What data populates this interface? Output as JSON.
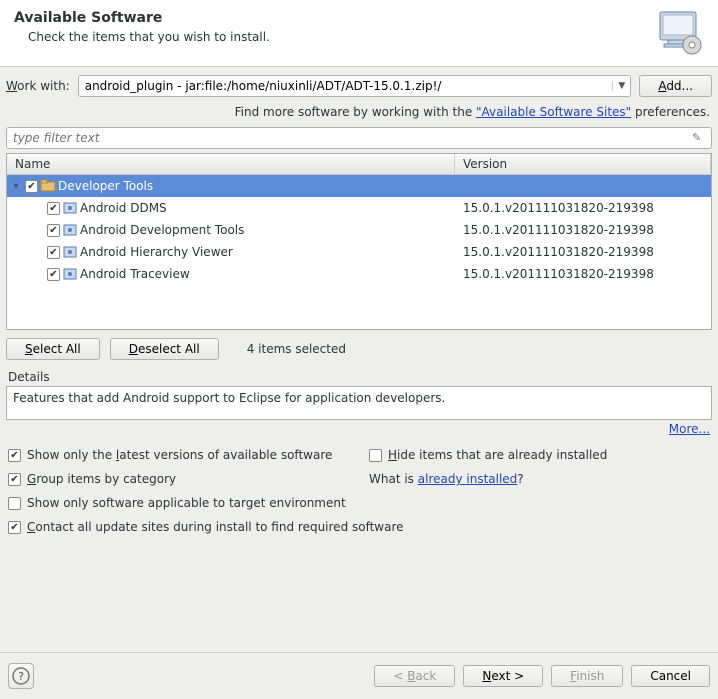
{
  "header": {
    "title": "Available Software",
    "subtitle": "Check the items that you wish to install."
  },
  "workwith": {
    "label_pre": "W",
    "label_post": "ork with:",
    "value": "android_plugin - jar:file:/home/niuxinli/ADT/ADT-15.0.1.zip!/",
    "add_btn_pre": "A",
    "add_btn_post": "dd..."
  },
  "hint": {
    "pre": "Find more software by working with the ",
    "link": "\"Available Software Sites\"",
    "post": " preferences."
  },
  "filter": {
    "placeholder": "type filter text"
  },
  "columns": {
    "name": "Name",
    "version": "Version"
  },
  "tree": {
    "group": {
      "label": "Developer Tools",
      "checked": true
    },
    "items": [
      {
        "label": "Android DDMS",
        "version": "15.0.1.v201111031820-219398",
        "checked": true
      },
      {
        "label": "Android Development Tools",
        "version": "15.0.1.v201111031820-219398",
        "checked": true
      },
      {
        "label": "Android Hierarchy Viewer",
        "version": "15.0.1.v201111031820-219398",
        "checked": true
      },
      {
        "label": "Android Traceview",
        "version": "15.0.1.v201111031820-219398",
        "checked": true
      }
    ]
  },
  "select": {
    "select_all_pre": "S",
    "select_all_post": "elect All",
    "deselect_all_pre": "D",
    "deselect_all_post": "eselect All",
    "count": "4 items selected"
  },
  "details": {
    "label": "Details",
    "text": "Features that add Android support to Eclipse for application developers.",
    "more": "More..."
  },
  "options": {
    "latest_pre": "Show only the ",
    "latest_u": "l",
    "latest_post": "atest versions of available software",
    "hide_pre": "",
    "hide_u": "H",
    "hide_post": "ide items that are already installed",
    "group_pre": "",
    "group_u": "G",
    "group_post": "roup items by category",
    "whatis_pre": "What is ",
    "whatis_link": "already installed",
    "whatis_post": "?",
    "target": "Show only software applicable to target environment",
    "contact_pre": "",
    "contact_u": "C",
    "contact_post": "ontact all update sites during install to find required software"
  },
  "footer": {
    "back_pre": "< ",
    "back_u": "B",
    "back_post": "ack",
    "next_pre": "",
    "next_u": "N",
    "next_post": "ext >",
    "finish_pre": "",
    "finish_u": "F",
    "finish_post": "inish",
    "cancel": "Cancel"
  }
}
